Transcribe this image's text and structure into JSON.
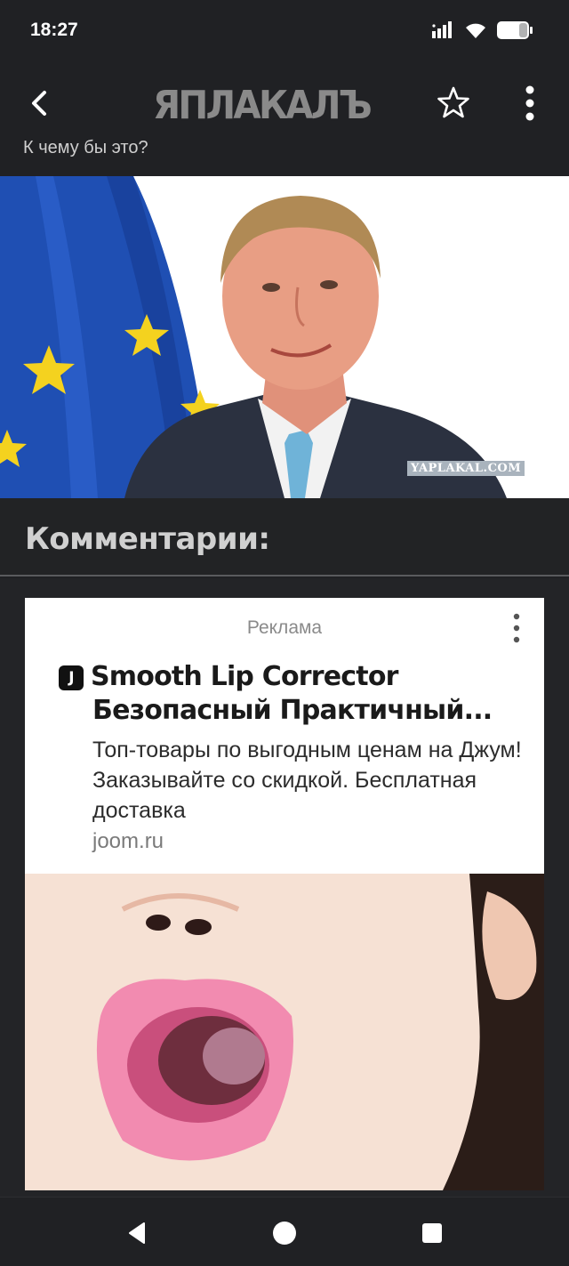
{
  "status": {
    "time": "18:27"
  },
  "app_bar": {
    "logo_text": "ЯПЛАКАЛЪ"
  },
  "post": {
    "caption": "К чему бы это?",
    "image_watermark": "YAPLAKAL.COM"
  },
  "comments": {
    "title": "Комментарии:"
  },
  "ad": {
    "label": "Реклама",
    "brand_icon_glyph": "J",
    "title_line1": "Smooth Lip Corrector",
    "title_line2": "Безопасный Практичный...",
    "description": "Топ-товары по выгодным ценам на Джум! Заказывайте со скидкой. Бесплатная доставка",
    "domain": "joom.ru"
  },
  "colors": {
    "background": "#202124",
    "ad_background": "#ffffff",
    "eu_flag_blue": "#1f4fb3",
    "eu_star_yellow": "#f4d21f"
  },
  "icons": {
    "back": "back-arrow-icon",
    "favorite": "star-outline-icon",
    "overflow": "more-vertical-icon",
    "ad_overflow": "more-vertical-icon",
    "nav_back": "nav-back-triangle-icon",
    "nav_home": "nav-home-circle-icon",
    "nav_recent": "nav-recent-square-icon"
  }
}
